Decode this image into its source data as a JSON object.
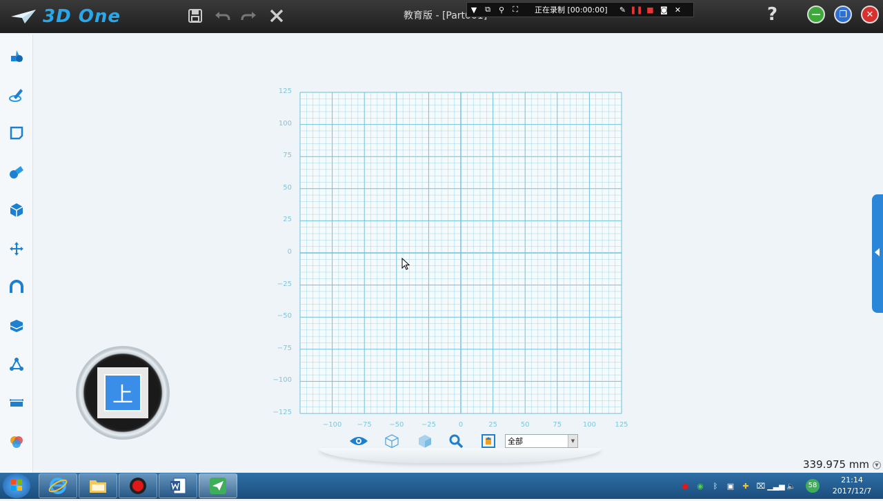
{
  "app": {
    "logo_text": "3D One",
    "title": "教育版 - [Part001]"
  },
  "recorder": {
    "status": "正在录制 [00:00:00]"
  },
  "help_label": "?",
  "grid": {
    "y_labels": [
      "125",
      "100",
      "75",
      "50",
      "25",
      "0",
      "−25",
      "−50",
      "−75",
      "−100",
      "−125"
    ],
    "x_labels": [
      "−100",
      "−75",
      "−50",
      "−25",
      "0",
      "25",
      "50",
      "75",
      "100",
      "125"
    ]
  },
  "viewcube": {
    "face_label": "上"
  },
  "filter": {
    "selected": "全部"
  },
  "measure": {
    "value": "339.975 mm"
  },
  "clock": {
    "time": "21:14",
    "date": "2017/12/7"
  },
  "tray": {
    "badge": "58"
  },
  "colors": {
    "accent": "#2aa7e8",
    "grid_line": "#9fd6ea",
    "grid_major": "#6cc0dc"
  }
}
